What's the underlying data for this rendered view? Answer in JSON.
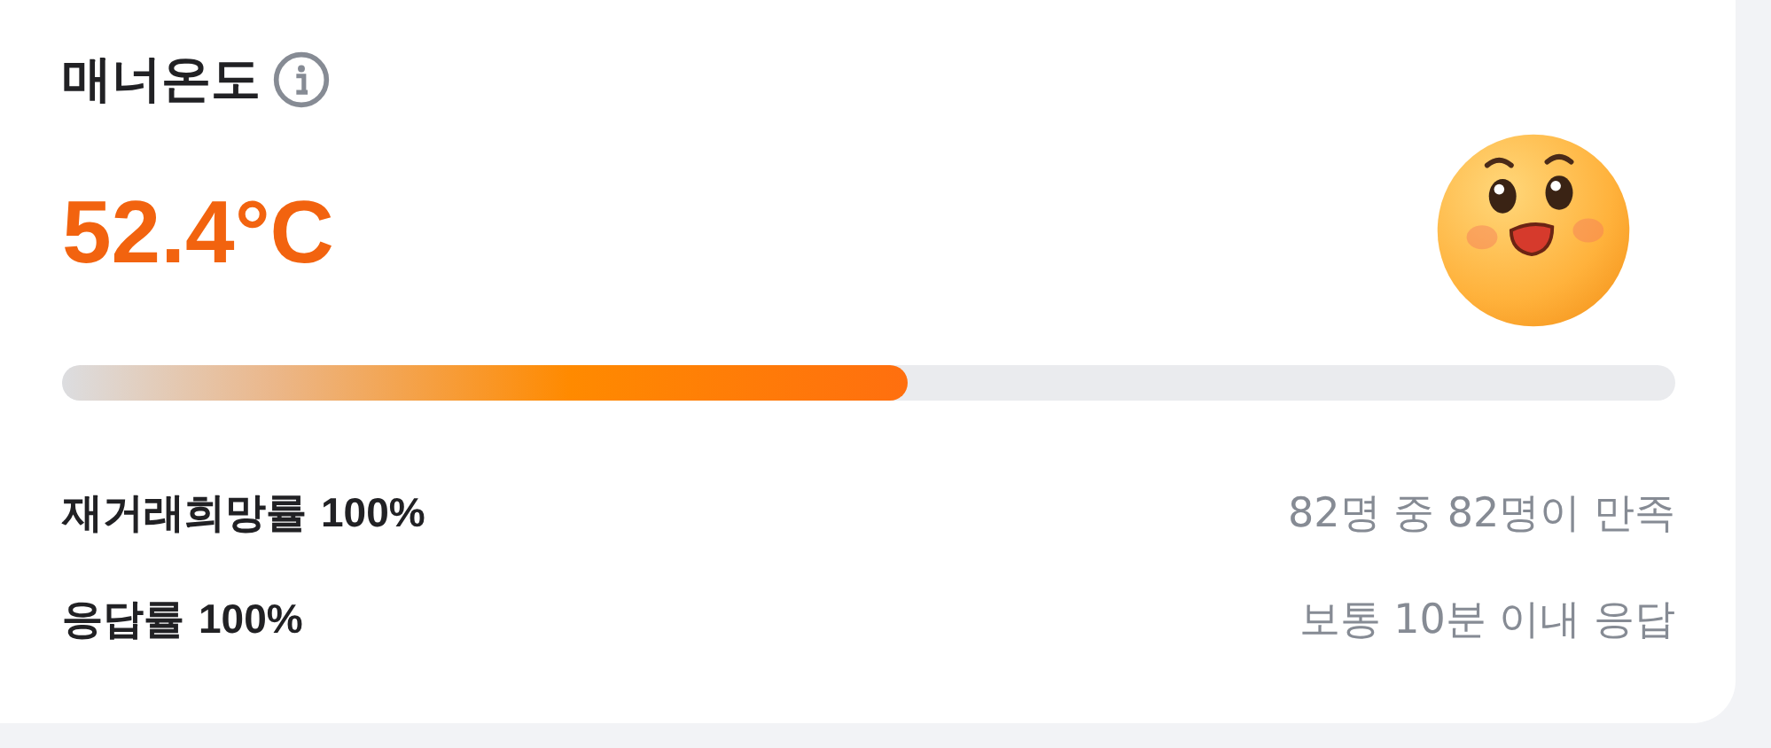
{
  "title": "매너온도",
  "temperature": "52.4°C",
  "meter": {
    "level": 0.524
  },
  "stats": [
    {
      "label": "재거래희망률",
      "value": "100%",
      "detail": "82명 중 82명이 만족"
    },
    {
      "label": "응답률",
      "value": "100%",
      "detail": "보통 10분 이내 응답"
    }
  ]
}
